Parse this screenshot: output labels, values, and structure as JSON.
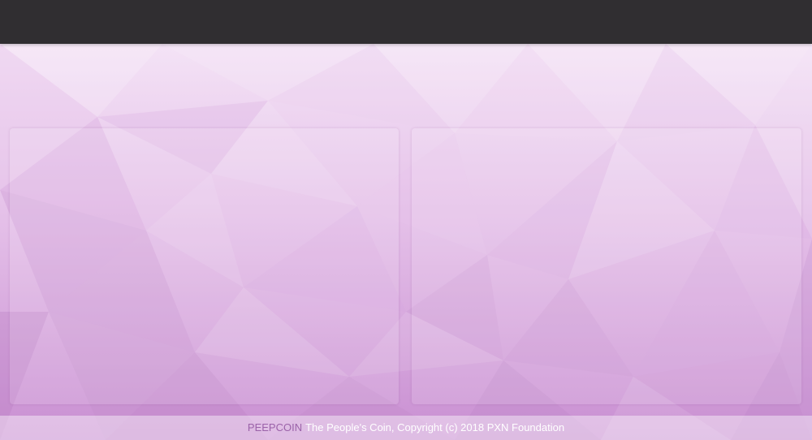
{
  "footer": {
    "brand": "PEEPCOIN",
    "text": "The People's Coin, Copyright (c) 2018 PXN Foundation"
  },
  "colors": {
    "topbar": "#302e31",
    "background": "#d9b3df",
    "brand": "#9b62a9",
    "footer_text": "#ffffff"
  }
}
